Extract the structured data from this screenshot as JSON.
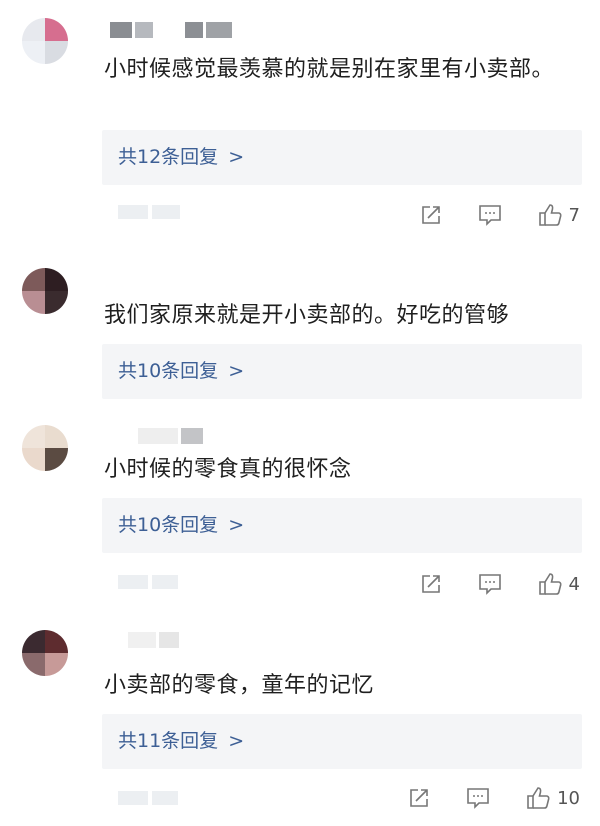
{
  "comments": [
    {
      "text": "小时候感觉最羡慕的就是别在家里有小卖部。",
      "replies_label": "共12条回复",
      "likes": "7"
    },
    {
      "text": "我们家原来就是开小卖部的。好吃的管够",
      "replies_label": "共10条回复",
      "likes": ""
    },
    {
      "text": "小时候的零食真的很怀念",
      "replies_label": "共10条回复",
      "likes": "4"
    },
    {
      "text": "小卖部的零食，童年的记忆",
      "replies_label": "共11条回复",
      "likes": "10"
    }
  ],
  "icons": {
    "share": "share-icon",
    "comment": "comment-icon",
    "like": "thumbs-up-icon",
    "chevron": "chevron-right-icon"
  },
  "colors": {
    "reply_link": "#3d5f95",
    "reply_bg": "#f4f5f7"
  }
}
